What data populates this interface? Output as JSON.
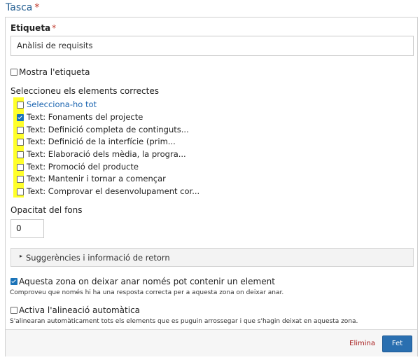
{
  "header": {
    "title": "Tasca",
    "required_mark": "*"
  },
  "label_field": {
    "label": "Etiqueta",
    "required_mark": "*",
    "value": "Anàlisi de requisits"
  },
  "show_label": {
    "label": "Mostra l'etiqueta",
    "checked": false
  },
  "elements": {
    "heading": "Seleccioneu els elements correctes",
    "select_all_label": "Selecciona-ho tot",
    "options": [
      {
        "label": "Text: Fonaments del projecte",
        "checked": true
      },
      {
        "label": "Text: Definició completa de continguts...",
        "checked": false
      },
      {
        "label": "Text: Definició de la interfície (prim...",
        "checked": false
      },
      {
        "label": "Text: Elaboració dels mèdia, la progra...",
        "checked": false
      },
      {
        "label": "Text: Promoció del producte",
        "checked": false
      },
      {
        "label": "Text: Mantenir i tornar a començar",
        "checked": false
      },
      {
        "label": "Text: Comprovar el desenvolupament cor...",
        "checked": false
      }
    ],
    "highlight_color": "#ffff2a"
  },
  "opacity": {
    "label": "Opacitat del fons",
    "value": "0"
  },
  "feedback": {
    "label": "Suggerències i informació de retorn"
  },
  "single_element": {
    "label": "Aquesta zona on deixar anar només pot contenir un element",
    "help": "Comproveu que només hi ha una resposta correcta per a aquesta zona on deixar anar.",
    "checked": true
  },
  "auto_align": {
    "label": "Activa l'alineació automàtica",
    "help": "S'alinearan automàticament tots els elements que es puguin arrossegar i que s'hagin deixat en aquesta zona.",
    "checked": false
  },
  "footer": {
    "delete_label": "Elimina",
    "done_label": "Fet"
  },
  "colors": {
    "accent": "#2a6fb0",
    "title": "#1f5b8f",
    "delete": "#a61b1b",
    "required": "#c0392b"
  }
}
